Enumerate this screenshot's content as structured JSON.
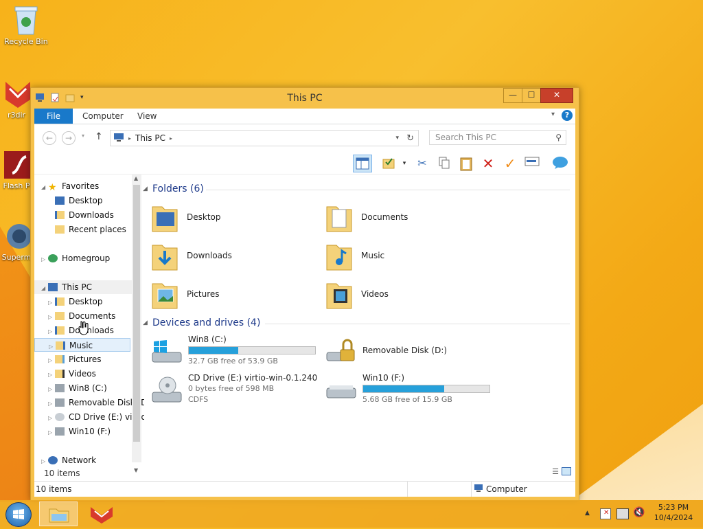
{
  "desktop": {
    "icons": [
      {
        "label": "Recycle Bin"
      },
      {
        "label": "r3dir"
      },
      {
        "label": "Flash P"
      },
      {
        "label": "Superm"
      }
    ]
  },
  "window": {
    "title": "This PC",
    "buttons": {
      "minimize": "—",
      "maximize": "☐",
      "close": "✕"
    },
    "ribbon": {
      "tabs": [
        "File",
        "Computer",
        "View"
      ]
    },
    "address": {
      "location": "This PC",
      "search_placeholder": "Search This PC"
    },
    "navpane": {
      "favorites_label": "Favorites",
      "favorites": [
        "Desktop",
        "Downloads",
        "Recent places"
      ],
      "homegroup": "Homegroup",
      "thispc": "This PC",
      "pc_items": [
        "Desktop",
        "Documents",
        "Downloads",
        "Music",
        "Pictures",
        "Videos",
        "Win8 (C:)",
        "Removable Disk (D:)",
        "CD Drive (E:) virtio-win-0.1.240",
        "Win10 (F:)"
      ],
      "network": "Network",
      "items_count": "10 items"
    },
    "content": {
      "folders_header": "Folders (6)",
      "folders": [
        "Desktop",
        "Documents",
        "Downloads",
        "Music",
        "Pictures",
        "Videos"
      ],
      "devices_header": "Devices and drives (4)",
      "drives": [
        {
          "name": "Win8 (C:)",
          "free": "32.7 GB free of 53.9 GB",
          "used_fraction": 0.39
        },
        {
          "name": "Removable Disk (D:)"
        },
        {
          "name": "CD Drive (E:) virtio-win-0.1.240",
          "free": "0 bytes free of 598 MB",
          "fs": "CDFS"
        },
        {
          "name": "Win10 (F:)",
          "free": "5.68 GB free of 15.9 GB",
          "used_fraction": 0.64
        }
      ]
    },
    "status": {
      "items": "10 items",
      "computer": "Computer"
    }
  },
  "taskbar": {
    "time": "5:23 PM",
    "date": "10/4/2024"
  },
  "colors": {
    "accent": "#1979ca",
    "drive_bar": "#26a0da",
    "header_blue": "#1e3a8a"
  }
}
